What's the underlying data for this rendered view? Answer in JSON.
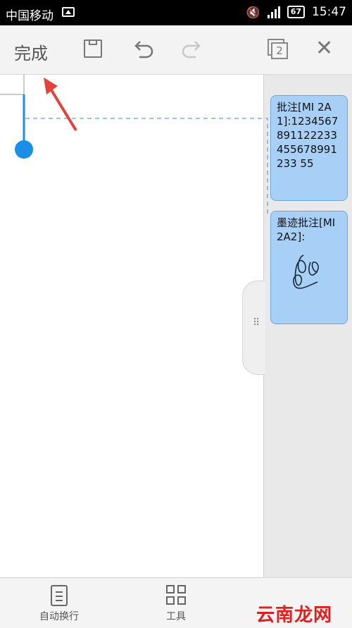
{
  "status_bar": {
    "carrier": "中国移动",
    "battery": "67",
    "time": "15:47"
  },
  "toolbar": {
    "done_label": "完成"
  },
  "pages_count": "2",
  "comments": [
    {
      "text": "批注[MI 2A1]:1234567891122233455678991233 55"
    },
    {
      "title": "墨迹批注[MI 2A2]:"
    }
  ],
  "bottom_bar": {
    "wrap_label": "自动换行",
    "tools_label": "工具"
  },
  "watermark": "云南龙网",
  "colors": {
    "comment_fill": "#a8cff5",
    "cursor_blue": "#1a8fe8",
    "arrow_red": "#e0443a"
  }
}
